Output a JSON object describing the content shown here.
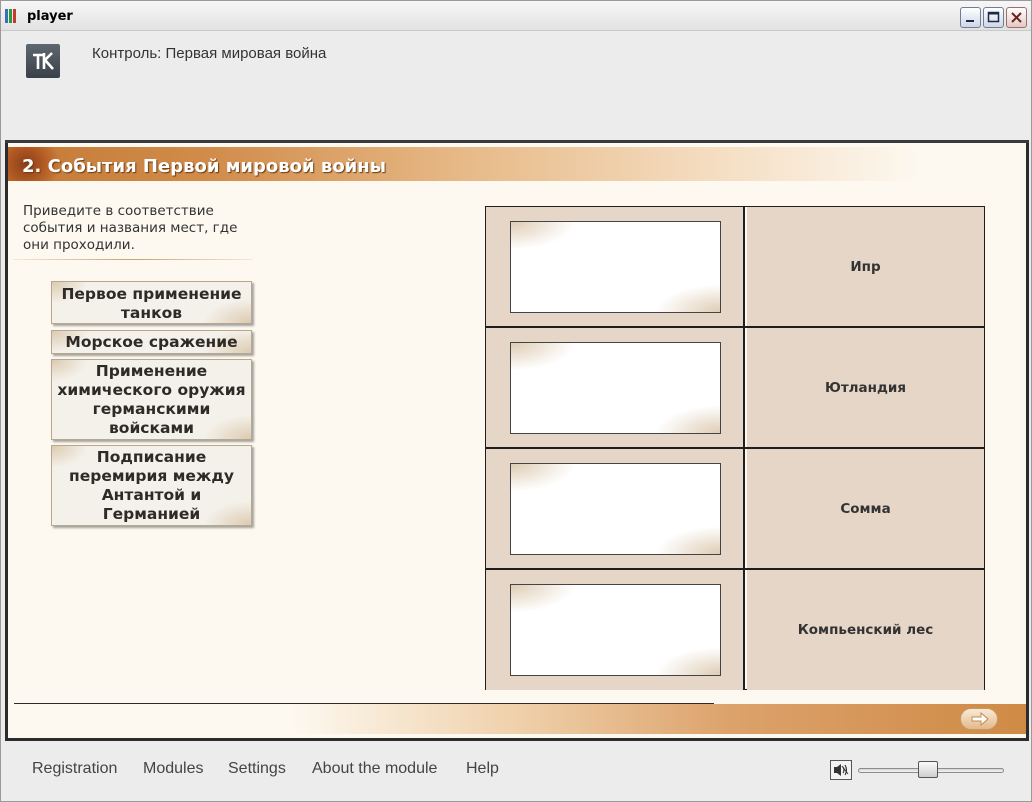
{
  "window": {
    "title": "player"
  },
  "header": {
    "logo_icon": "k-logo-icon",
    "title": "Контроль: Первая мировая война"
  },
  "section": {
    "title": "2. События Первой мировой войны"
  },
  "task": {
    "instruction": "Приведите в соответствие события и названия мест, где они проходили."
  },
  "events": [
    {
      "label": "Первое применение танков"
    },
    {
      "label": "Морское сражение"
    },
    {
      "label": "Применение химического оружия германскими войсками"
    },
    {
      "label": "Подписание перемирия между Антантой и Германией"
    }
  ],
  "places": [
    {
      "label": "Ипр"
    },
    {
      "label": "Ютландия"
    },
    {
      "label": "Сомма"
    },
    {
      "label": "Компьенский лес"
    }
  ],
  "footer": {
    "menu": [
      "Registration",
      "Modules",
      "Settings",
      "About the module",
      "Help"
    ],
    "volume_percent": 48
  },
  "colors": {
    "accent_band": "#c47a35",
    "table_cell": "#e6d6c8",
    "page_bg": "#fdf9f1"
  }
}
